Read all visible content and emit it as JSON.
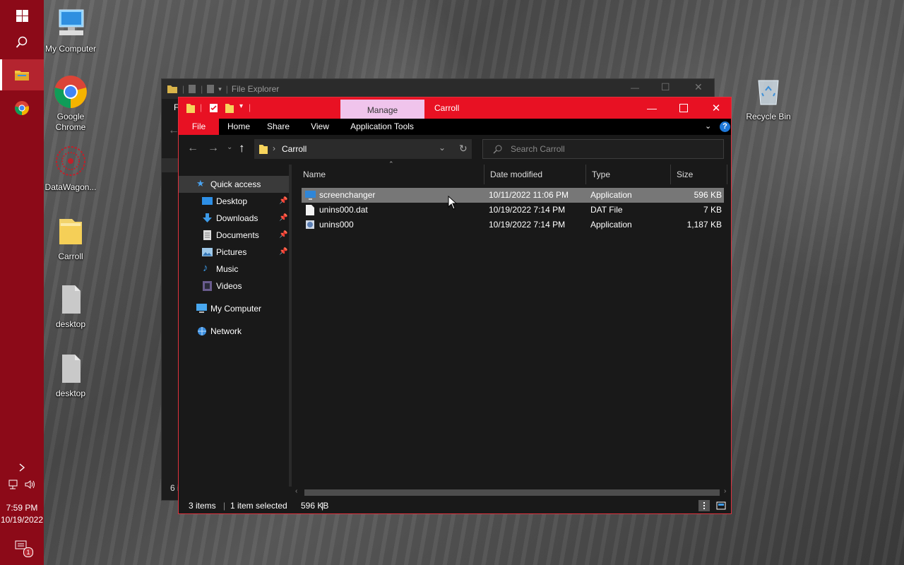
{
  "taskbar": {
    "time": "7:59 PM",
    "date": "10/19/2022",
    "notification_count": "1"
  },
  "desktop": {
    "icons": [
      {
        "label": "My Computer"
      },
      {
        "label": "Google Chrome"
      },
      {
        "label": "DataWagon..."
      },
      {
        "label": "Carroll"
      },
      {
        "label": "desktop"
      },
      {
        "label": "desktop"
      },
      {
        "label": "Recycle Bin"
      }
    ]
  },
  "bg_window": {
    "title": "File Explorer",
    "ribbon_letter": "F",
    "status_fragment": "6 i"
  },
  "window": {
    "title": "Carroll",
    "context_tab": "Manage",
    "ribbon_tabs": [
      "File",
      "Home",
      "Share",
      "View",
      "Application Tools"
    ],
    "breadcrumb": "Carroll",
    "search_placeholder": "Search Carroll",
    "nav": {
      "quick_access": "Quick access",
      "items": [
        {
          "label": "Desktop"
        },
        {
          "label": "Downloads"
        },
        {
          "label": "Documents"
        },
        {
          "label": "Pictures"
        },
        {
          "label": "Music"
        },
        {
          "label": "Videos"
        }
      ],
      "my_computer": "My Computer",
      "network": "Network"
    },
    "columns": [
      "Name",
      "Date modified",
      "Type",
      "Size"
    ],
    "files": [
      {
        "name": "screenchanger",
        "date": "10/11/2022 11:06 PM",
        "type": "Application",
        "size": "596 KB",
        "selected": true
      },
      {
        "name": "unins000.dat",
        "date": "10/19/2022 7:14 PM",
        "type": "DAT File",
        "size": "7 KB",
        "selected": false
      },
      {
        "name": "unins000",
        "date": "10/19/2022 7:14 PM",
        "type": "Application",
        "size": "1,187 KB",
        "selected": false
      }
    ],
    "status": {
      "items": "3 items",
      "selected": "1 item selected",
      "size": "596 KB"
    }
  },
  "colors": {
    "accent": "#e81123",
    "taskbar": "#8c0a18",
    "manage_tab": "#f0c4ec"
  }
}
